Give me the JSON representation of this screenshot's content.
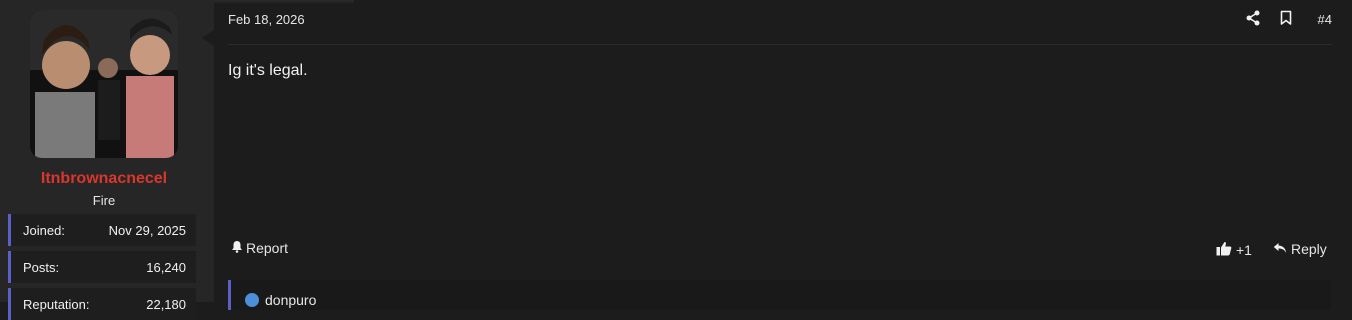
{
  "user": {
    "username": "Itnbrownacnecel",
    "title": "Fire",
    "username_color": "#d9372d",
    "stats": [
      {
        "label": "Joined:",
        "value": "Nov 29, 2025"
      },
      {
        "label": "Posts:",
        "value": "16,240"
      },
      {
        "label": "Reputation:",
        "value": "22,180"
      }
    ]
  },
  "post": {
    "date": "Feb 18, 2026",
    "number": "#4",
    "body": "Ig it's legal.",
    "icons": {
      "share": "share-icon",
      "bookmark": "bookmark-icon"
    }
  },
  "actions": {
    "report_label": "Report",
    "like_label": "+1",
    "reply_label": "Reply"
  },
  "quote": {
    "author": "donpuro"
  },
  "colors": {
    "accent": "#5b5fc7",
    "background": "#1c1c1c",
    "sidebar": "#262626"
  }
}
